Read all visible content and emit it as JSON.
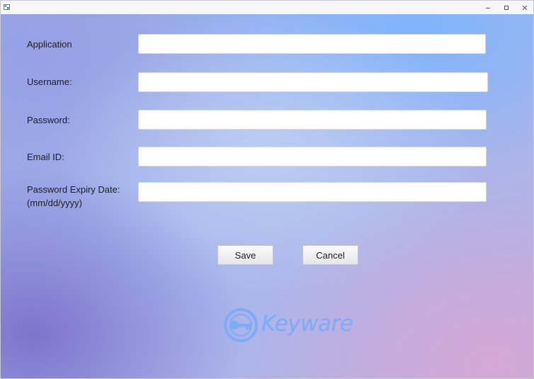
{
  "window": {
    "controls": {
      "minimize": "–",
      "maximize": "□",
      "close": "✕"
    }
  },
  "form": {
    "fields": [
      {
        "label": "Application",
        "value": "",
        "placeholder": ""
      },
      {
        "label": "Username:",
        "value": "",
        "placeholder": ""
      },
      {
        "label": "Password:",
        "value": "",
        "placeholder": ""
      },
      {
        "label": "Email ID:",
        "value": "",
        "placeholder": ""
      },
      {
        "label": "Password Expiry Date:\n(mm/dd/yyyy)",
        "value": "",
        "placeholder": ""
      }
    ],
    "buttons": {
      "save": "Save",
      "cancel": "Cancel"
    }
  },
  "branding": {
    "logo_text": "Keyware",
    "logo_icon": "key-in-circle-icon",
    "logo_color": "#7cabf8"
  }
}
